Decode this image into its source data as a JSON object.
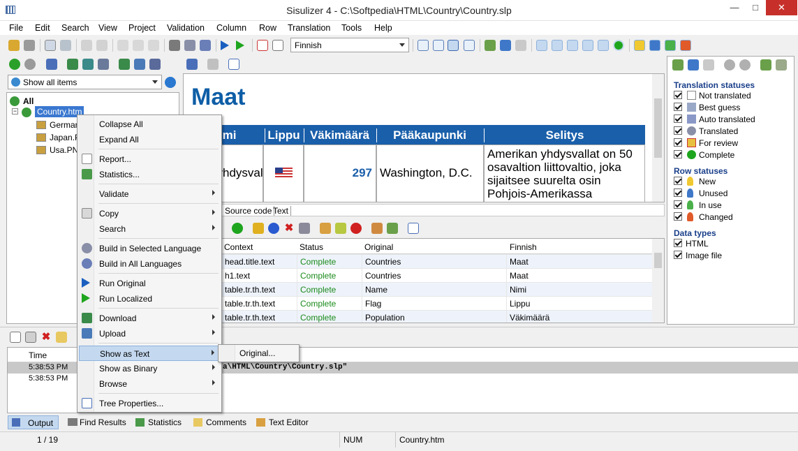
{
  "window": {
    "title": "Sisulizer 4 - C:\\Softpedia\\HTML\\Country\\Country.slp"
  },
  "menu": [
    "File",
    "Edit",
    "Search",
    "View",
    "Project",
    "Validation",
    "Column",
    "Row",
    "Translation",
    "Tools",
    "Help"
  ],
  "toolbar": {
    "language": "Finnish"
  },
  "left": {
    "filter": "Show all items",
    "tree": {
      "root": "All",
      "file": "Country.htm",
      "children": [
        "Germany.PNG",
        "Japan.PNG",
        "Usa.PNG"
      ]
    }
  },
  "preview": {
    "heading": "Maat",
    "columns": [
      "Nimi",
      "Lippu",
      "Väkimäärä",
      "Pääkaupunki",
      "Selitys"
    ],
    "row": {
      "name": "Amerikan yhdysvallat",
      "population": "297",
      "capital": "Washington, D.C.",
      "description": "Amerikan yhdysvallat on 50 osavaltion liittovaltio, joka sijaitsee suurelta osin Pohjois-Amerikassa"
    }
  },
  "view_tabs": [
    "Source code",
    "Text"
  ],
  "grid": {
    "headers": [
      "Context",
      "Status",
      "Original",
      "Finnish"
    ],
    "rows": [
      [
        "head.title.text",
        "Complete",
        "Countries",
        "Maat"
      ],
      [
        "h1.text",
        "Complete",
        "Countries",
        "Maat"
      ],
      [
        "table.tr.th.text",
        "Complete",
        "Name",
        "Nimi"
      ],
      [
        "table.tr.th.text",
        "Complete",
        "Flag",
        "Lippu"
      ],
      [
        "table.tr.th.text",
        "Complete",
        "Population",
        "Väkimäärä"
      ]
    ]
  },
  "output": {
    "header": "Time",
    "rows": [
      {
        "time": "5:38:53 PM",
        "text": "a\\HTML\\Country\\Country.slp\""
      },
      {
        "time": "5:38:53 PM",
        "text": ""
      }
    ]
  },
  "bottom_tabs": [
    "Output",
    "Find Results",
    "Statistics",
    "Comments",
    "Text Editor"
  ],
  "status": {
    "position": "1 / 19",
    "num": "NUM",
    "file": "Country.htm"
  },
  "right": {
    "translation_statuses_title": "Translation statuses",
    "translation_statuses": [
      "Not translated",
      "Best guess",
      "Auto translated",
      "Translated",
      "For review",
      "Complete"
    ],
    "row_statuses_title": "Row statuses",
    "row_statuses": [
      "New",
      "Unused",
      "In use",
      "Changed"
    ],
    "data_types_title": "Data types",
    "data_types": [
      "HTML",
      "Image file"
    ]
  },
  "context_menu": {
    "items": [
      "Collapse All",
      "Expand All",
      "Report...",
      "Statistics...",
      "Validate",
      "Copy",
      "Search",
      "Build in Selected Language",
      "Build in All Languages",
      "Run Original",
      "Run Localized",
      "Download",
      "Upload",
      "Show as Text",
      "Show as Binary",
      "Browse",
      "Tree Properties..."
    ],
    "submenu": "Original..."
  },
  "colors": {
    "accent": "#0e5ea6",
    "status_complete": "#1a8a1a",
    "selection": "#c4d9ef"
  }
}
